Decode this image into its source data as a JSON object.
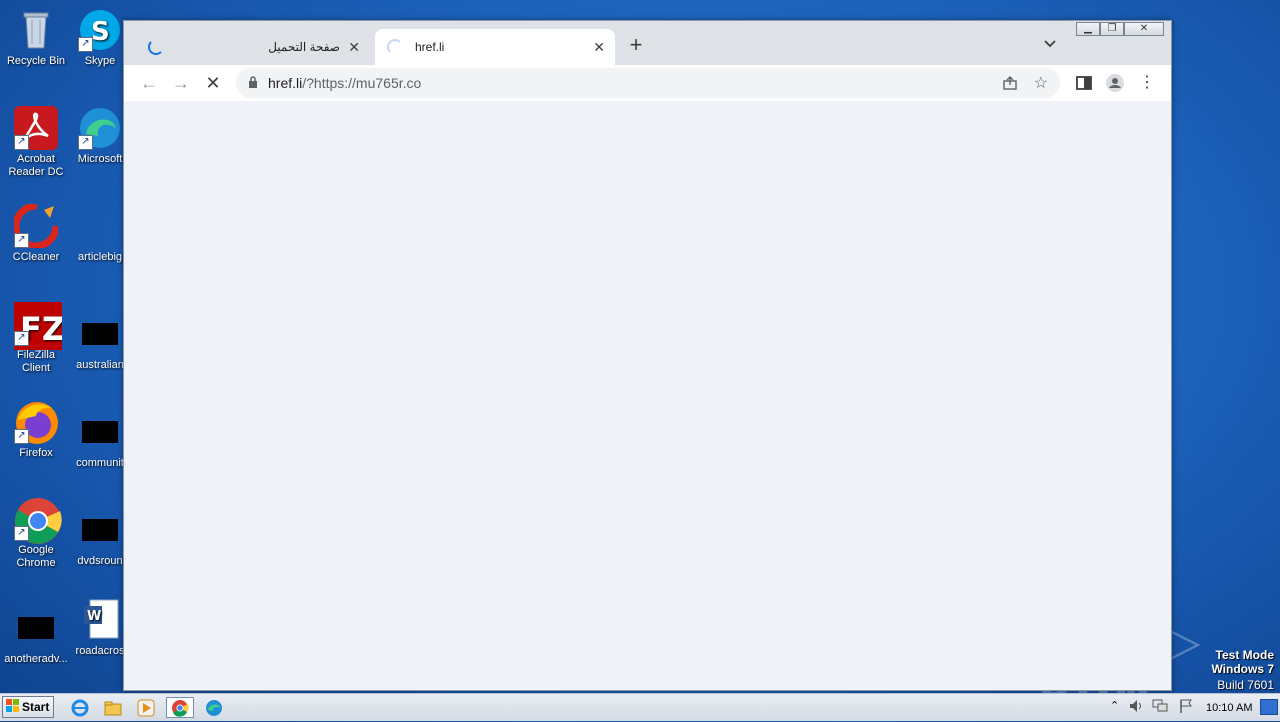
{
  "desktop": {
    "icons": [
      {
        "label": "Recycle Bin"
      },
      {
        "label": "Skype"
      },
      {
        "label": "Acrobat Reader DC"
      },
      {
        "label": "Microsoft"
      },
      {
        "label": "CCleaner"
      },
      {
        "label": "articlebig"
      },
      {
        "label": "FileZilla Client"
      },
      {
        "label": "australian"
      },
      {
        "label": "Firefox"
      },
      {
        "label": "communit"
      },
      {
        "label": "Google Chrome"
      },
      {
        "label": "dvdsroun"
      },
      {
        "label": "anotheradv..."
      },
      {
        "label": "roadacros"
      }
    ]
  },
  "browser": {
    "tabs": [
      {
        "title": "صفحة التحميل",
        "loading": true
      },
      {
        "title": "href.li",
        "loading": true,
        "active": true
      }
    ],
    "url_host": "href.li",
    "url_rest": "/?https://mu765r.co"
  },
  "watermark": {
    "brand": "ANY ▷ RUN",
    "line1": "Test Mode",
    "line2": "Windows 7",
    "line3": "Build 7601"
  },
  "taskbar": {
    "start_label": "Start",
    "clock": "10:10 AM"
  },
  "colors": {
    "desktop_blue": "#1f67c2",
    "chrome_frame": "#dee1e6",
    "spinner": "#1a73e8"
  }
}
